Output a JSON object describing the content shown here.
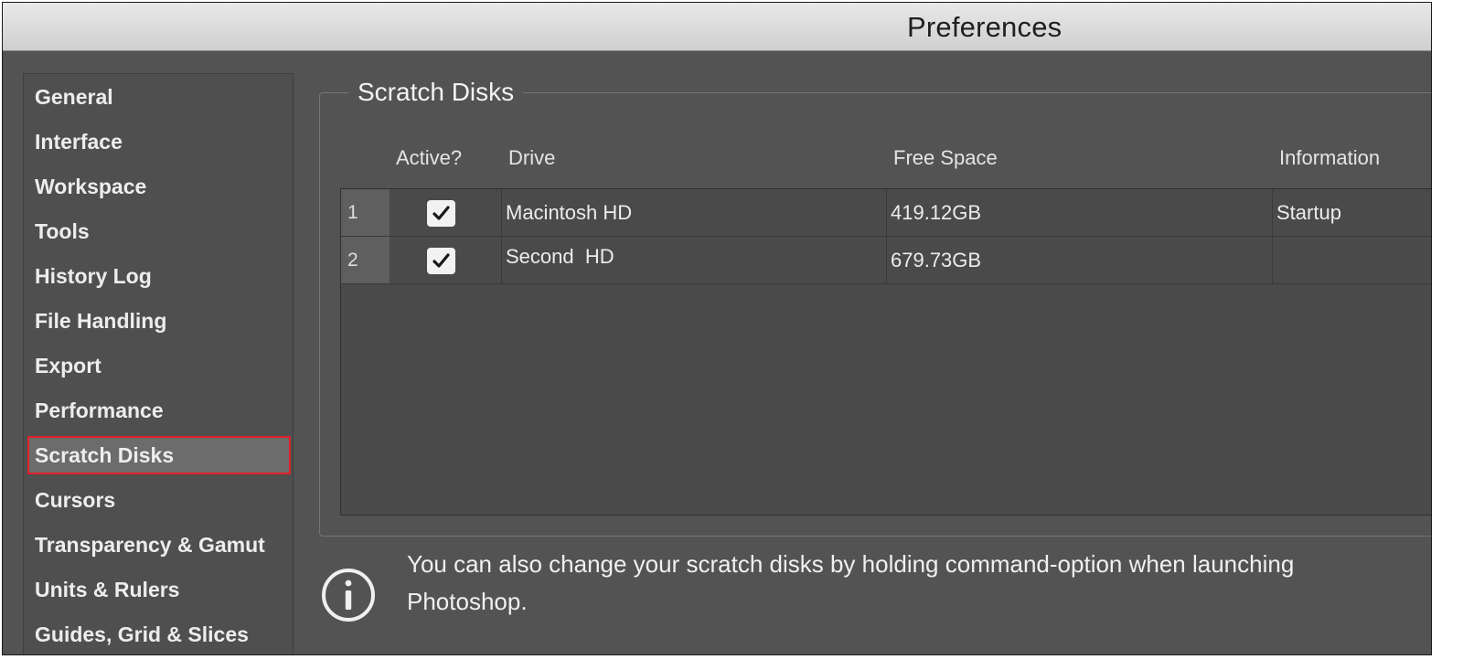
{
  "window": {
    "title": "Preferences"
  },
  "sidebar": {
    "items": [
      {
        "label": "General"
      },
      {
        "label": "Interface"
      },
      {
        "label": "Workspace"
      },
      {
        "label": "Tools"
      },
      {
        "label": "History Log"
      },
      {
        "label": "File Handling"
      },
      {
        "label": "Export"
      },
      {
        "label": "Performance"
      },
      {
        "label": "Scratch Disks",
        "selected": true
      },
      {
        "label": "Cursors"
      },
      {
        "label": "Transparency & Gamut"
      },
      {
        "label": "Units & Rulers"
      },
      {
        "label": "Guides, Grid & Slices"
      }
    ]
  },
  "section": {
    "title": "Scratch Disks"
  },
  "table": {
    "headers": {
      "active": "Active?",
      "drive": "Drive",
      "free_space": "Free Space",
      "information": "Information"
    },
    "rows": [
      {
        "index": "1",
        "active": true,
        "drive": "Macintosh HD",
        "free_space": "419.12GB",
        "information": "Startup"
      },
      {
        "index": "2",
        "active": true,
        "drive": "Second  HD",
        "free_space": "679.73GB",
        "information": ""
      }
    ]
  },
  "info": {
    "icon": "info-icon",
    "text": "You can also change your scratch disks by holding command-option when launching Photoshop."
  },
  "colors": {
    "panel_bg": "#535353",
    "selection_border": "#e0202a",
    "titlebar": "#dcdcdc"
  }
}
